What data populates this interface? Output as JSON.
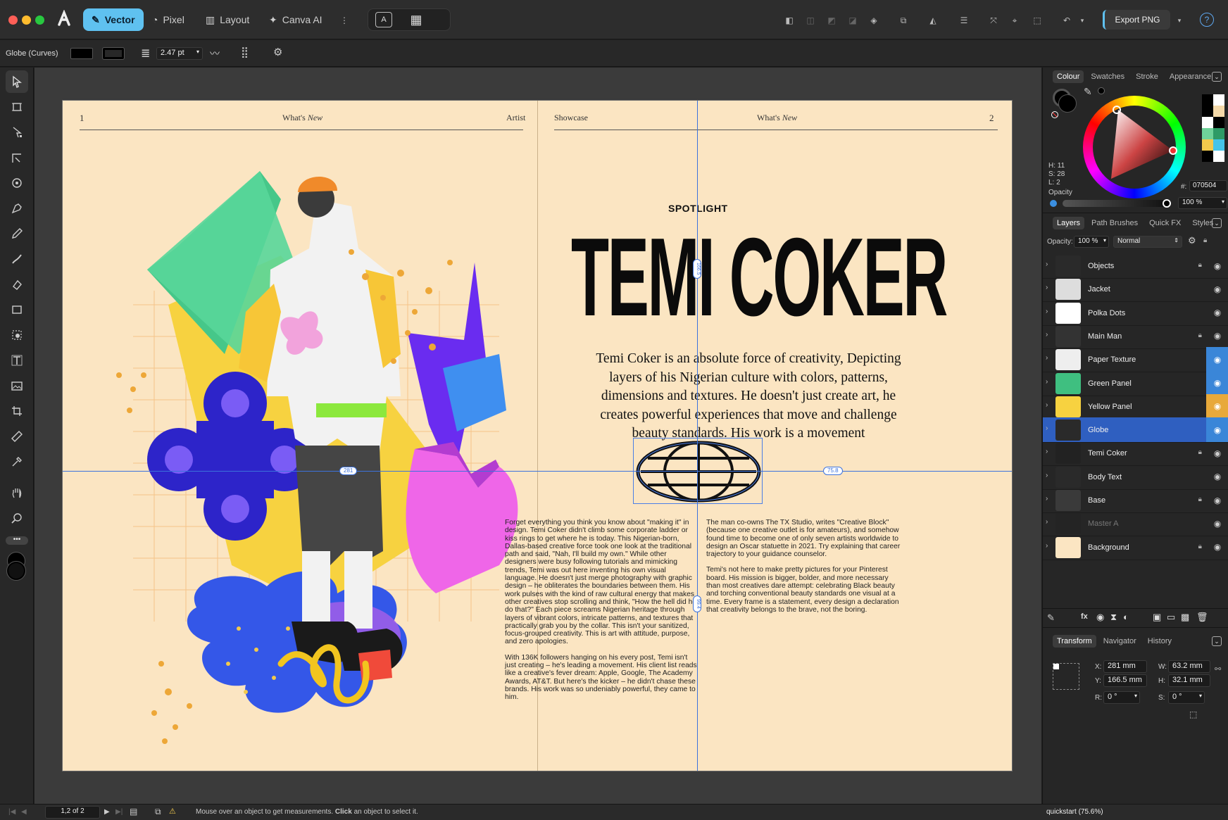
{
  "app": {
    "personas": [
      "Vector",
      "Pixel",
      "Layout",
      "Canva AI"
    ],
    "active_persona": "Vector",
    "export_label": "Export PNG",
    "help_icon": "?"
  },
  "context": {
    "selection_name": "Globe (Curves)",
    "stroke_width": "2.47 pt"
  },
  "document": {
    "left_page_number": "1",
    "header_center_left": "What's",
    "header_center_italic": "New",
    "header_right_left": "Artist",
    "header_left_right": "Showcase",
    "right_page_number": "2",
    "kicker": "SPOTLIGHT",
    "title": "TEMI COKER",
    "intro": "Temi Coker is an absolute force of creativity, Depicting layers of his Nigerian culture with colors, patterns, dimensions and textures. He doesn't just create art, he creates powerful experiences that move and challenge beauty standards. His work is a movement",
    "body_col1_p1": "Forget everything you think you know about \"making it\" in design. Temi Coker didn't climb some corporate ladder or kiss rings to get where he is today. This Nigerian-born, Dallas-based creative force took one look at the traditional path and said, \"Nah, I'll build my own.\" While other designers were busy following tutorials and mimicking trends, Temi was out here inventing his own visual language. He doesn't just merge photography with graphic design – he obliterates the boundaries between them. His work pulses with the kind of raw cultural energy that makes other creatives stop scrolling and think, \"How the hell did he do that?\" Each piece screams Nigerian heritage through layers of vibrant colors, intricate patterns, and textures that practically grab you by the collar. This isn't your sanitized, focus-grouped creativity. This is art with attitude, purpose, and zero apologies.",
    "body_col1_p2": "With 136K followers hanging on his every post, Temi isn't just creating – he's leading a movement. His client list reads like a creative's fever dream: Apple, Google, The Academy Awards, AT&T. But here's the kicker – he didn't chase these brands. His work was so undeniably powerful, they came to him.",
    "body_col2_p1": "The man co-owns The TX Studio, writes \"Creative Block\" (because one creative outlet is for amateurs), and somehow found time to become one of only seven artists worldwide to design an Oscar statuette in 2021. Try explaining that career trajectory to your guidance counselor.",
    "body_col2_p2": "Temi's not here to make pretty pictures for your Pinterest board. His mission is bigger, bolder, and more necessary than most creatives dare attempt: celebrating Black beauty and torching conventional beauty standards one visual at a time. Every frame is a statement, every design a declaration that creativity belongs to the brave, not the boring.",
    "guide_labels": {
      "left_dist": "281",
      "right_dist": "75.8",
      "top_dist": "166.5",
      "bottom_dist": "99.4"
    }
  },
  "colour_panel": {
    "tabs": [
      "Colour",
      "Swatches",
      "Stroke",
      "Appearance"
    ],
    "h": "H: 11",
    "s": "S: 28",
    "l": "L: 2",
    "hex_label": "#:",
    "hex": "070504",
    "opacity_label": "Opacity",
    "opacity_value": "100 %",
    "swatches": [
      "#000000",
      "#ffffff",
      "#000000",
      "#f4d9a9",
      "#ffffff",
      "#000000",
      "#6fd39a",
      "#2e9b66",
      "#f2c94c",
      "#44c4e8",
      "#000000",
      "#ffffff"
    ]
  },
  "layers_panel": {
    "tabs": [
      "Layers",
      "Path Brushes",
      "Quick FX",
      "Styles"
    ],
    "opacity_label": "Opacity:",
    "opacity_value": "100 %",
    "blend_mode": "Normal",
    "layers": [
      {
        "name": "Objects",
        "locked": true,
        "selected": false,
        "dim": false
      },
      {
        "name": "Jacket",
        "locked": false,
        "selected": false,
        "dim": false
      },
      {
        "name": "Polka Dots",
        "locked": false,
        "selected": false,
        "dim": false
      },
      {
        "name": "Main Man",
        "locked": true,
        "selected": false,
        "dim": false
      },
      {
        "name": "Paper Texture",
        "locked": false,
        "selected": false,
        "dim": false
      },
      {
        "name": "Green Panel",
        "locked": false,
        "selected": false,
        "dim": false
      },
      {
        "name": "Yellow Panel",
        "locked": false,
        "selected": false,
        "dim": false
      },
      {
        "name": "Globe",
        "locked": false,
        "selected": true,
        "dim": false
      },
      {
        "name": "Temi Coker",
        "locked": true,
        "selected": false,
        "dim": false
      },
      {
        "name": "Body Text",
        "locked": false,
        "selected": false,
        "dim": false
      },
      {
        "name": "Base",
        "locked": true,
        "selected": false,
        "dim": false
      },
      {
        "name": "Master A",
        "locked": false,
        "selected": false,
        "dim": true
      },
      {
        "name": "Background",
        "locked": true,
        "selected": false,
        "dim": false
      }
    ]
  },
  "transform_panel": {
    "tabs": [
      "Transform",
      "Navigator",
      "History"
    ],
    "x_label": "X:",
    "x": "281 mm",
    "y_label": "Y:",
    "y": "166.5 mm",
    "w_label": "W:",
    "w": "63.2 mm",
    "h_label": "H:",
    "h": "32.1 mm",
    "r_label": "R:",
    "r": "0 °",
    "s_label": "S:",
    "s": "0 °"
  },
  "status": {
    "page_indicator": "1,2 of 2",
    "hint_prefix": "Mouse over an object to get measurements.",
    "hint_bold": "Click",
    "hint_suffix": "an object to select it.",
    "document_zoom": "quickstart (75.6%)"
  }
}
